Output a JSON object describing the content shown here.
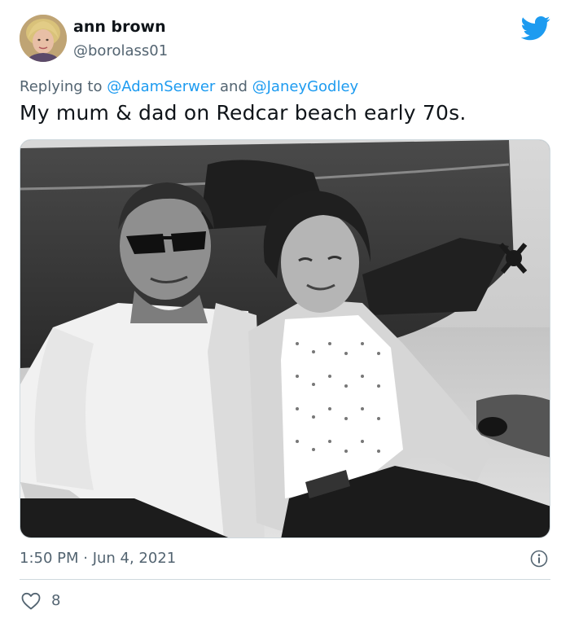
{
  "author": {
    "display_name": "ann brown",
    "handle": "@borolass01"
  },
  "reply": {
    "prefix": "Replying to ",
    "mention1": "@AdamSerwer",
    "joiner": " and ",
    "mention2": "@JaneyGodley"
  },
  "tweet": {
    "text": "My mum & dad on Redcar beach early 70s."
  },
  "meta": {
    "timestamp": "1:50 PM · Jun 4, 2021"
  },
  "stats": {
    "likes": "8"
  },
  "icons": {
    "brand": "twitter-bird-icon",
    "info": "info-icon",
    "like": "heart-icon"
  },
  "colors": {
    "brand": "#1d9bf0",
    "secondary_text": "#536471",
    "primary_text": "#0f1419",
    "divider": "#cfd9de"
  }
}
